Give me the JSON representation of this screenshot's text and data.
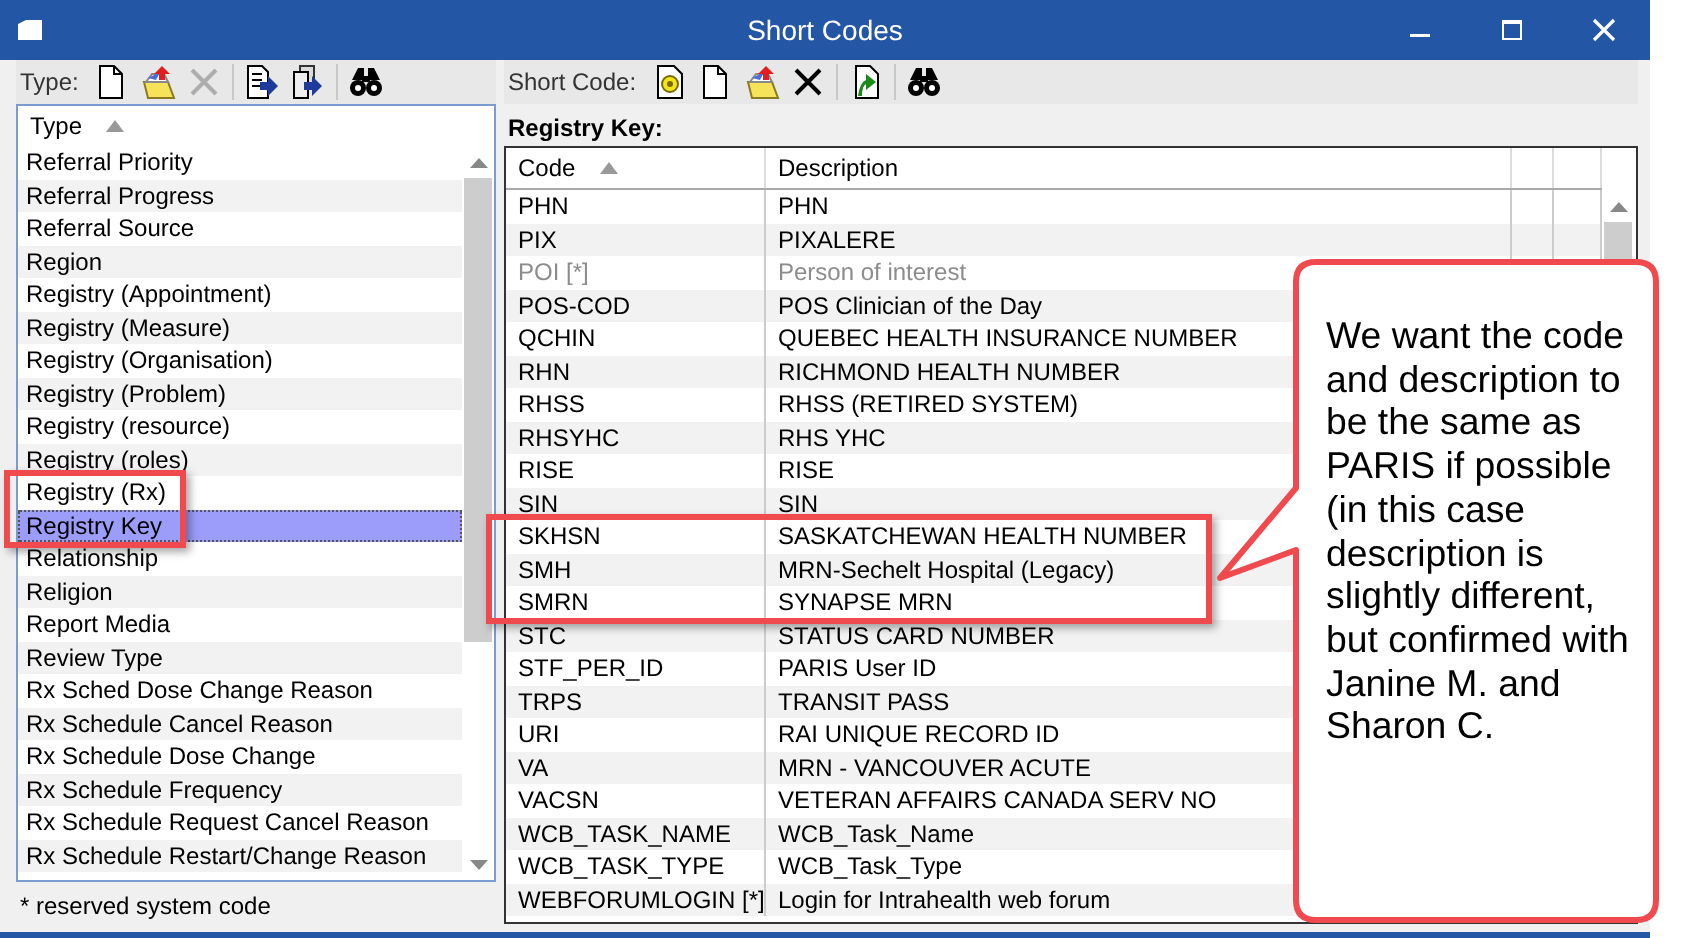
{
  "window": {
    "title": "Short Codes"
  },
  "type_panel": {
    "toolbar": {
      "label": "Type:",
      "tools": [
        {
          "kind": "new",
          "disabled": false
        },
        {
          "kind": "open",
          "disabled": false
        },
        {
          "kind": "delete",
          "disabled": true
        },
        {
          "kind": "export",
          "disabled": false
        },
        {
          "kind": "copy",
          "disabled": false
        },
        {
          "kind": "find",
          "disabled": false
        }
      ]
    },
    "list": {
      "column": "Type",
      "items": [
        {
          "label": "Referral Priority",
          "selected": false
        },
        {
          "label": "Referral Progress",
          "selected": false
        },
        {
          "label": "Referral Source",
          "selected": false
        },
        {
          "label": "Region",
          "selected": false
        },
        {
          "label": "Registry (Appointment)",
          "selected": false
        },
        {
          "label": "Registry (Measure)",
          "selected": false
        },
        {
          "label": "Registry (Organisation)",
          "selected": false
        },
        {
          "label": "Registry (Problem)",
          "selected": false
        },
        {
          "label": "Registry (resource)",
          "selected": false
        },
        {
          "label": "Registry (roles)",
          "selected": false
        },
        {
          "label": "Registry (Rx)",
          "selected": false
        },
        {
          "label": "Registry Key",
          "selected": true
        },
        {
          "label": "Relationship",
          "selected": false
        },
        {
          "label": "Religion",
          "selected": false
        },
        {
          "label": "Report Media",
          "selected": false
        },
        {
          "label": "Review Type",
          "selected": false
        },
        {
          "label": "Rx Sched Dose Change Reason",
          "selected": false
        },
        {
          "label": "Rx Schedule Cancel Reason",
          "selected": false
        },
        {
          "label": "Rx Schedule Dose Change",
          "selected": false
        },
        {
          "label": "Rx Schedule Frequency",
          "selected": false
        },
        {
          "label": "Rx Schedule Request Cancel Reason",
          "selected": false
        },
        {
          "label": "Rx Schedule Restart/Change Reason",
          "selected": false
        }
      ]
    },
    "footnote": "* reserved system code"
  },
  "codes_panel": {
    "toolbar": {
      "label": "Short Code:",
      "tools": [
        {
          "kind": "properties",
          "disabled": false
        },
        {
          "kind": "new",
          "disabled": false
        },
        {
          "kind": "open",
          "disabled": false
        },
        {
          "kind": "delete",
          "disabled": false
        },
        {
          "kind": "refresh",
          "disabled": false
        },
        {
          "kind": "find",
          "disabled": false
        }
      ]
    },
    "heading": "Registry Key:",
    "table": {
      "columns": [
        "Code",
        "Description"
      ],
      "rows": [
        {
          "code": "PHN",
          "description": "PHN",
          "disabled": false
        },
        {
          "code": "PIX",
          "description": "PIXALERE",
          "disabled": false
        },
        {
          "code": "POI [*]",
          "description": "Person of interest",
          "disabled": true
        },
        {
          "code": "POS-COD",
          "description": "POS Clinician of the Day",
          "disabled": false
        },
        {
          "code": "QCHIN",
          "description": "QUEBEC HEALTH INSURANCE NUMBER",
          "disabled": false
        },
        {
          "code": "RHN",
          "description": "RICHMOND HEALTH NUMBER",
          "disabled": false
        },
        {
          "code": "RHSS",
          "description": "RHSS (RETIRED SYSTEM)",
          "disabled": false
        },
        {
          "code": "RHSYHC",
          "description": "RHS YHC",
          "disabled": false
        },
        {
          "code": "RISE",
          "description": "RISE",
          "disabled": false
        },
        {
          "code": "SIN",
          "description": "SIN",
          "disabled": false
        },
        {
          "code": "SKHSN",
          "description": "SASKATCHEWAN HEALTH NUMBER",
          "disabled": false
        },
        {
          "code": "SMH",
          "description": "MRN-Sechelt Hospital (Legacy)",
          "disabled": false
        },
        {
          "code": "SMRN",
          "description": "SYNAPSE MRN",
          "disabled": false
        },
        {
          "code": "STC",
          "description": "STATUS CARD NUMBER",
          "disabled": false
        },
        {
          "code": "STF_PER_ID",
          "description": "PARIS User ID",
          "disabled": false
        },
        {
          "code": "TRPS",
          "description": "TRANSIT PASS",
          "disabled": false
        },
        {
          "code": "URI",
          "description": "RAI UNIQUE RECORD ID",
          "disabled": false
        },
        {
          "code": "VA",
          "description": "MRN - VANCOUVER ACUTE",
          "disabled": false
        },
        {
          "code": "VACSN",
          "description": "VETERAN AFFAIRS CANADA SERV NO",
          "disabled": false
        },
        {
          "code": "WCB_TASK_NAME",
          "description": "WCB_Task_Name",
          "disabled": false
        },
        {
          "code": "WCB_TASK_TYPE",
          "description": "WCB_Task_Type",
          "disabled": false
        },
        {
          "code": "WEBFORUMLOGIN [*]",
          "description": "Login for Intrahealth web forum",
          "disabled": false
        }
      ]
    }
  },
  "annotation": {
    "callout": "We want the code and description to be the same as PARIS if possible (in this case description is slightly different, but confirmed with Janine M. and Sharon C."
  }
}
